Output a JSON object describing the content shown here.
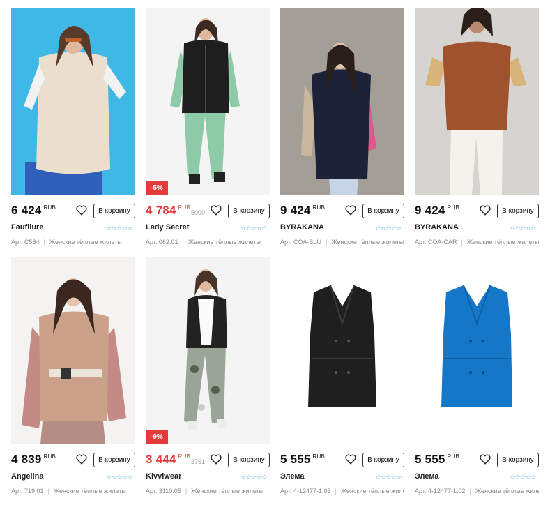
{
  "colors": {
    "accent": "#e53a3a",
    "stars": "#4aa9d9"
  },
  "cart_label": "В корзину",
  "products": [
    {
      "price": "6 424",
      "currency": "RUB",
      "old_price": "",
      "discount": "",
      "sale": false,
      "brand": "Faufilure",
      "article": "Арт. C564",
      "category": "Женские тёплые жилеты",
      "rating": "☆☆☆☆☆"
    },
    {
      "price": "4 784",
      "currency": "RUB",
      "old_price": "5000",
      "discount": "-5%",
      "sale": true,
      "brand": "Lady Secret",
      "article": "Арт. 062.01",
      "category": "Женские тёплые жилеты",
      "rating": "☆☆☆☆☆"
    },
    {
      "price": "9 424",
      "currency": "RUB",
      "old_price": "",
      "discount": "",
      "sale": false,
      "brand": "BYRAKANA",
      "article": "Арт. COA-BLU",
      "category": "Женские тёплые жилеты",
      "rating": "☆☆☆☆☆"
    },
    {
      "price": "9 424",
      "currency": "RUB",
      "old_price": "",
      "discount": "",
      "sale": false,
      "brand": "BYRAKANA",
      "article": "Арт. COA-CAR",
      "category": "Женские тёплые жилеты",
      "rating": "☆☆☆☆☆"
    },
    {
      "price": "4 839",
      "currency": "RUB",
      "old_price": "",
      "discount": "",
      "sale": false,
      "brand": "Angelina",
      "article": "Арт. 719.01",
      "category": "Женские тёплые жилеты",
      "rating": "☆☆☆☆☆"
    },
    {
      "price": "3 444",
      "currency": "RUB",
      "old_price": "3751",
      "discount": "-9%",
      "sale": true,
      "brand": "Kivviwear",
      "article": "Арт. 3110.05",
      "category": "Женские тёплые жилеты",
      "rating": "☆☆☆☆☆"
    },
    {
      "price": "5 555",
      "currency": "RUB",
      "old_price": "",
      "discount": "",
      "sale": false,
      "brand": "Элема",
      "article": "Арт. 4-12477-1.03",
      "category": "Женские тёплые жилеты",
      "rating": "☆☆☆☆☆"
    },
    {
      "price": "5 555",
      "currency": "RUB",
      "old_price": "",
      "discount": "",
      "sale": false,
      "brand": "Элема",
      "article": "Арт. 4-12477-1.02",
      "category": "Женские тёплые жилеты",
      "rating": "☆☆☆☆☆"
    }
  ]
}
